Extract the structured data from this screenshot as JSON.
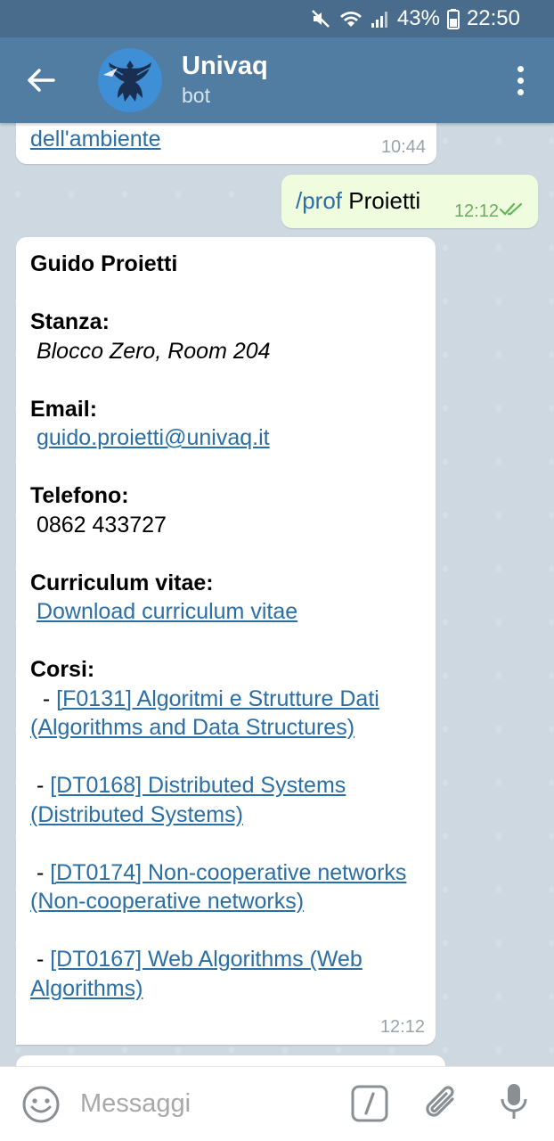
{
  "status_bar": {
    "battery": "43%",
    "time": "22:50"
  },
  "header": {
    "title": "Univaq",
    "subtitle": "bot"
  },
  "messages": {
    "previous": {
      "link_text": "dell'ambiente",
      "time": "10:44"
    },
    "outgoing": {
      "command": "/prof",
      "text": " Proietti",
      "time": "12:12"
    },
    "incoming": {
      "name": "Guido Proietti",
      "room_label": "Stanza:",
      "room_value": " Blocco Zero, Room 204",
      "email_label": "Email:",
      "email_value": "guido.proietti@univaq.it",
      "phone_label": "Telefono:",
      "phone_value": " 0862 433727",
      "cv_label": "Curriculum vitae:",
      "cv_link": "Download curriculum vitae",
      "courses_label": "Corsi:",
      "courses": [
        {
          "prefix": "  - ",
          "link": "[F0131] Algoritmi e Strutture Dati (Algorithms and Data Structures)"
        },
        {
          "prefix": " - ",
          "link": "[DT0168] Distributed Systems (Distributed Systems)"
        },
        {
          "prefix": " - ",
          "link": "[DT0174] Non-cooperative networks (Non-cooperative networks)"
        },
        {
          "prefix": " - ",
          "link": "[DT0167] Web Algorithms (Web Algorithms)"
        }
      ],
      "time": "12:12"
    }
  },
  "input": {
    "placeholder": "Messaggi"
  },
  "colors": {
    "header": "#527da3",
    "status_bar": "#4a6c8c",
    "link": "#2a6ea6",
    "outgoing_bubble": "#effdde"
  }
}
